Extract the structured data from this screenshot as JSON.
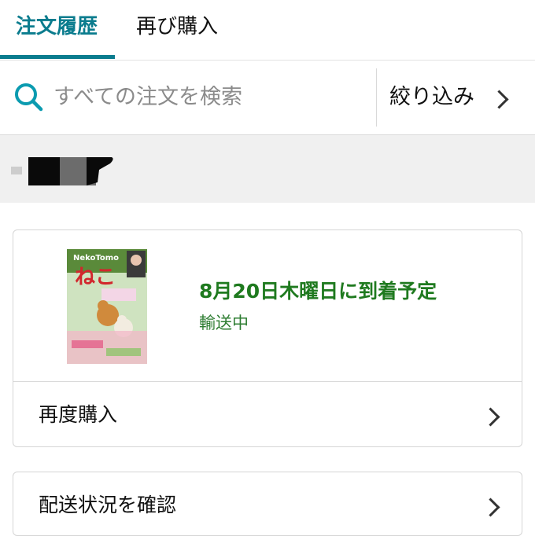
{
  "tabs": [
    {
      "label": "注文履歴",
      "active": true
    },
    {
      "label": "再び購入",
      "active": false
    }
  ],
  "search": {
    "placeholder": "すべての注文を検索",
    "icon": "search-icon"
  },
  "filter": {
    "label": "絞り込み",
    "icon": "chevron-right-icon"
  },
  "order": {
    "delivery_date": "8月20日木曜日に到着予定",
    "status": "輸送中",
    "product_image": {
      "brand_text": "NekoTomo",
      "title_text": "ねこ"
    }
  },
  "actions": [
    {
      "label": "再度購入",
      "icon": "chevron-right-icon"
    },
    {
      "label": "配送状況を確認",
      "icon": "chevron-right-icon"
    }
  ],
  "colors": {
    "accent": "#0b7c8e",
    "delivery_green": "#1f7a1f",
    "band_gray": "#f0f0f0"
  }
}
